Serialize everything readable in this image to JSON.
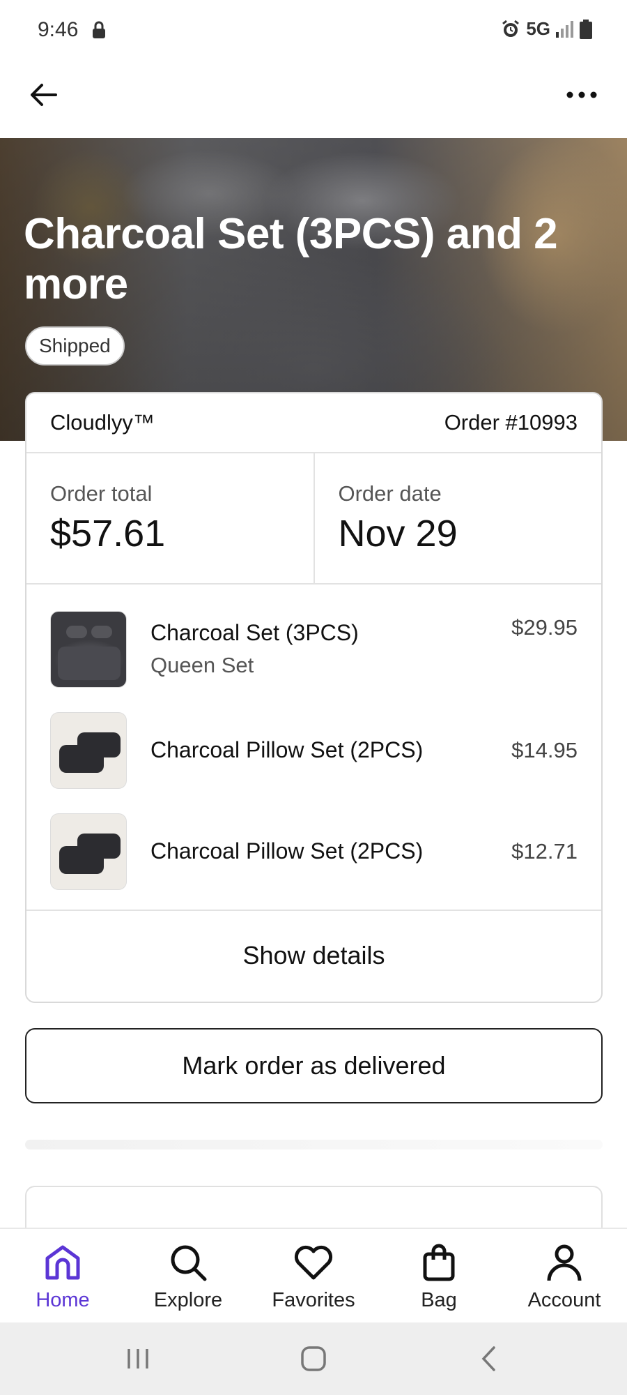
{
  "status_bar": {
    "time": "9:46",
    "network": "5G"
  },
  "hero": {
    "title": "Charcoal Set (3PCS) and 2 more",
    "status": "Shipped"
  },
  "order": {
    "shop": "Cloudlyy™",
    "number": "Order #10993",
    "total_label": "Order total",
    "total_value": "$57.61",
    "date_label": "Order date",
    "date_value": "Nov 29",
    "items": [
      {
        "name": "Charcoal Set (3PCS)",
        "variant": "Queen Set",
        "price": "$29.95"
      },
      {
        "name": "Charcoal Pillow Set (2PCS)",
        "variant": "",
        "price": "$14.95"
      },
      {
        "name": "Charcoal Pillow Set (2PCS)",
        "variant": "",
        "price": "$12.71"
      }
    ],
    "show_details": "Show details"
  },
  "actions": {
    "mark_delivered": "Mark order as delivered"
  },
  "nav": [
    {
      "label": "Home",
      "icon": "home-icon",
      "active": true
    },
    {
      "label": "Explore",
      "icon": "search-icon",
      "active": false
    },
    {
      "label": "Favorites",
      "icon": "heart-icon",
      "active": false
    },
    {
      "label": "Bag",
      "icon": "bag-icon",
      "active": false
    },
    {
      "label": "Account",
      "icon": "person-icon",
      "active": false
    }
  ],
  "colors": {
    "accent": "#5b35d5",
    "text": "#111111",
    "border": "#d9d9d9"
  }
}
